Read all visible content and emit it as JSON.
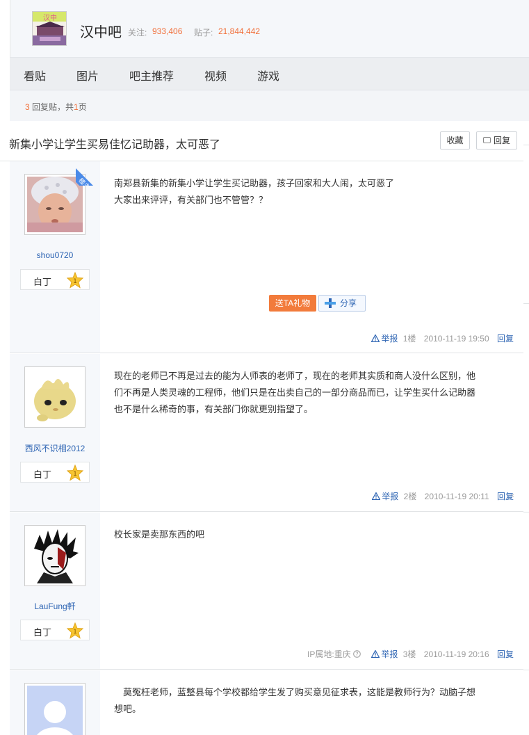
{
  "forum": {
    "name": "汉中吧",
    "follow_label": "关注:",
    "follow_count": "933,406",
    "posts_label": "贴子:",
    "posts_count": "21,844,442"
  },
  "nav": {
    "tabs": [
      "看贴",
      "图片",
      "吧主推荐",
      "视频",
      "游戏"
    ]
  },
  "info": {
    "reply_count": "3",
    "reply_text": "回复贴，共",
    "page_count": "1",
    "page_text": "页"
  },
  "thread": {
    "title": "新集小学让学生买易佳忆记助器，太可恶了",
    "fav_label": "收藏",
    "reply_label": "回复"
  },
  "posts": [
    {
      "username": "shou0720",
      "level": "白丁",
      "level_num": "1",
      "badge": "楼主",
      "lines": [
        "南郑县新集的新集小学让学生买记助器，孩子回家和大人闹，太可恶了",
        "大家出来评评，有关部门也不管管？？"
      ],
      "gift_label": "送TA礼物",
      "share_label": "分享",
      "report": "举报",
      "floor": "1楼",
      "date": "2010-11-19 19:50",
      "reply": "回复"
    },
    {
      "username": "西风不识相2012",
      "level": "白丁",
      "level_num": "1",
      "lines": [
        "现在的老师已不再是过去的能为人师表的老师了，现在的老师其实质和商人没什么区别，他",
        "们不再是人类灵魂的工程师，他们只是在出卖自己的一部分商品而已，让学生买什么记助器",
        "也不是什么稀奇的事，有关部门你就更别指望了。"
      ],
      "report": "举报",
      "floor": "2楼",
      "date": "2010-11-19 20:11",
      "reply": "回复"
    },
    {
      "username": "LauFung軒",
      "level": "白丁",
      "level_num": "1",
      "lines": [
        "校长家是卖那东西的吧"
      ],
      "ip": "IP属地:重庆",
      "report": "举报",
      "floor": "3楼",
      "date": "2010-11-19 20:16",
      "reply": "回复"
    },
    {
      "lines": [
        "　莫冤枉老师，蓝整县每个学校都给学生发了购买意见征求表，这能是教师行为？动脑子想",
        "想吧。"
      ]
    }
  ],
  "colors": {
    "accent_orange": "#f16f3a",
    "link_blue": "#2d64b3",
    "badge_blue": "#4a8ae8"
  }
}
